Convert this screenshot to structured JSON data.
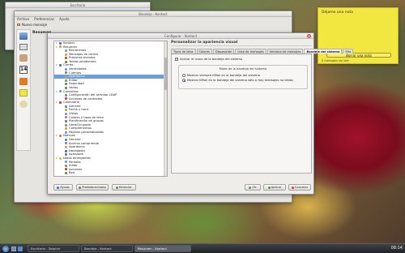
{
  "colors": {
    "tree_selected": "#6c9fd9",
    "note_bg": "#f2e641",
    "desktop_accent": "#a0122a"
  },
  "note": {
    "title": "Déjame una nota",
    "button": "Borrar una nota",
    "footer": "0 mensajes sin leer"
  },
  "back_window": {
    "title": "Escritorio"
  },
  "kontact_window": {
    "title": "Bandeja - Kontact",
    "menu": [
      "Archivo",
      "Preferencias",
      "Ayuda"
    ],
    "toolbar": "Nuevo mensaje",
    "side_label": "Resumen"
  },
  "dialog": {
    "title": "Configurar - Kontact",
    "panel_title": "Personalizar la apariencia visual",
    "tree": [
      {
        "label": "Kontact",
        "depth": 0,
        "exp": "▾",
        "color": "#3a73c9"
      },
      {
        "label": "Resumen",
        "depth": 0,
        "exp": "▾",
        "color": "#d3a437"
      },
      {
        "label": "Resúmenes",
        "depth": 1,
        "exp": "",
        "color": "#6b9dd6"
      },
      {
        "label": "Mensajes de correo",
        "depth": 1,
        "exp": "",
        "color": "#d3a437"
      },
      {
        "label": "Próximos eventos",
        "depth": 1,
        "exp": "",
        "color": "#c0483a"
      },
      {
        "label": "Tareas pendientes",
        "depth": 1,
        "exp": "",
        "color": "#4f9a43"
      },
      {
        "label": "Correo",
        "depth": 0,
        "exp": "▾",
        "color": "#3a73c9"
      },
      {
        "label": "Identidades",
        "depth": 1,
        "exp": "",
        "color": "#6b9dd6"
      },
      {
        "label": "Cuentas",
        "depth": 1,
        "exp": "",
        "color": "#4a8fd6"
      },
      {
        "label": "Apariencia",
        "depth": 1,
        "exp": "",
        "color": "#d3a437",
        "sel": true
      },
      {
        "label": "Editor",
        "depth": 1,
        "exp": "",
        "color": "#888888"
      },
      {
        "label": "Seguridad",
        "depth": 1,
        "exp": "",
        "color": "#4f9a43"
      },
      {
        "label": "Varios",
        "depth": 1,
        "exp": "",
        "color": "#777777"
      },
      {
        "label": "Contactos",
        "depth": 0,
        "exp": "▾",
        "color": "#6b9dd6"
      },
      {
        "label": "Configuración del servidor LDAP",
        "depth": 1,
        "exp": "",
        "color": "#888888"
      },
      {
        "label": "Acciones de contactos",
        "depth": 1,
        "exp": "",
        "color": "#c0483a"
      },
      {
        "label": "Calendario",
        "depth": 0,
        "exp": "▾",
        "color": "#c0483a"
      },
      {
        "label": "General",
        "depth": 1,
        "exp": "",
        "color": "#4a8fd6"
      },
      {
        "label": "Fecha y hora",
        "depth": 1,
        "exp": "",
        "color": "#d3a437"
      },
      {
        "label": "Vistas",
        "depth": 1,
        "exp": "",
        "color": "#6b9dd6"
      },
      {
        "label": "Colores y tipos de letra",
        "depth": 1,
        "exp": "",
        "color": "#c46fd0"
      },
      {
        "label": "Planificación de grupos",
        "depth": 1,
        "exp": "",
        "color": "#4f9a43"
      },
      {
        "label": "Libre/Ocupado",
        "depth": 1,
        "exp": "",
        "color": "#888888"
      },
      {
        "label": "Complementos",
        "depth": 1,
        "exp": "",
        "color": "#d3a437"
      },
      {
        "label": "Páginas personalizadas",
        "depth": 1,
        "exp": "",
        "color": "#6b9dd6"
      },
      {
        "label": "Noticias",
        "depth": 0,
        "exp": "▾",
        "color": "#e07a2a"
      },
      {
        "label": "General",
        "depth": 1,
        "exp": "",
        "color": "#4a8fd6"
      },
      {
        "label": "Archivo comprimido",
        "depth": 1,
        "exp": "",
        "color": "#888888"
      },
      {
        "label": "Apariencia",
        "depth": 1,
        "exp": "",
        "color": "#d3a437"
      },
      {
        "label": "Navegador",
        "depth": 1,
        "exp": "",
        "color": "#3a73c9"
      },
      {
        "label": "Avanzado",
        "depth": 1,
        "exp": "",
        "color": "#777777"
      },
      {
        "label": "Notas emergentes",
        "depth": 0,
        "exp": "▾",
        "color": "#e0c53a"
      },
      {
        "label": "Pantalla",
        "depth": 1,
        "exp": "",
        "color": "#6b9dd6"
      },
      {
        "label": "Editor",
        "depth": 1,
        "exp": "",
        "color": "#888888"
      },
      {
        "label": "Acciones",
        "depth": 1,
        "exp": "",
        "color": "#c0483a"
      },
      {
        "label": "Red",
        "depth": 1,
        "exp": "",
        "color": "#4f9a43"
      }
    ],
    "tabs": [
      {
        "label": "Tipos de letra",
        "active": false
      },
      {
        "label": "Colores",
        "active": false
      },
      {
        "label": "Disposición",
        "active": false
      },
      {
        "label": "Lista de mensajes",
        "active": false
      },
      {
        "label": "Ventana de mensajes",
        "active": false
      },
      {
        "label": "Bandeja del sistema",
        "active": true
      },
      {
        "label": "Etiq",
        "active": false
      }
    ],
    "enable_tray_label": "Activar el icono de la bandeja del sistema",
    "group_title": "Modo de la bandeja del sistema",
    "radio_always": "Mostrar siempre KMail en la bandeja del sistema",
    "radio_new": "Mostrar KMail en la bandeja del sistema sólo si hay mensajes no leídos",
    "buttons": {
      "help": "Ayuda",
      "defaults": "Predeterminado",
      "reset": "Reiniciar",
      "ok": "OK",
      "apply": "Aplicar",
      "cancel": "Cancelar"
    }
  },
  "taskbar": {
    "items": [
      "Escritorio - Dolphin",
      "Bandeja - Kontact",
      "Resumen - Kontact"
    ],
    "clock": "08:14"
  }
}
